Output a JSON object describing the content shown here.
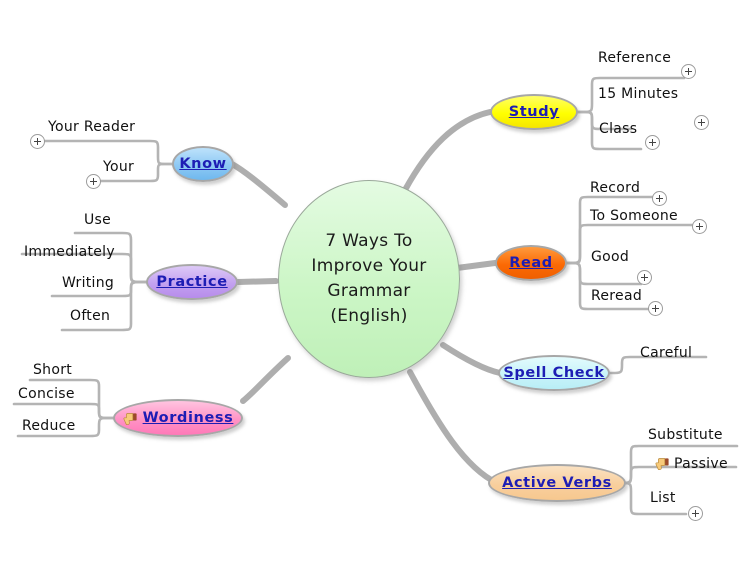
{
  "map": {
    "title": "7 Ways To Improve Your Grammar (English)",
    "central": {
      "lines": [
        "7 Ways To",
        "Improve Your",
        "Grammar",
        "(English)"
      ],
      "text": "7 Ways To\nImprove Your\nGrammar\n(English)",
      "fill": "#ccf6c6",
      "border": "#9aa89a"
    },
    "branches": [
      {
        "id": "know",
        "label": "Know",
        "side": "left",
        "fill": "#8ec9f4",
        "icon": null,
        "children": [
          {
            "label": "Your Reader",
            "plus": true,
            "icon": null
          },
          {
            "label": "Your",
            "plus": true,
            "icon": null
          }
        ]
      },
      {
        "id": "practice",
        "label": "Practice",
        "side": "left",
        "fill": "#c3a1f0",
        "icon": null,
        "children": [
          {
            "label": "Use",
            "plus": false,
            "icon": null
          },
          {
            "label": "Immediately",
            "plus": false,
            "icon": null
          },
          {
            "label": "Writing",
            "plus": false,
            "icon": null
          },
          {
            "label": "Often",
            "plus": false,
            "icon": null
          }
        ]
      },
      {
        "id": "wordiness",
        "label": "Wordiness",
        "side": "left",
        "fill": "#ff93c6",
        "icon": "thumbs-down-icon",
        "children": [
          {
            "label": "Short",
            "plus": false,
            "icon": null
          },
          {
            "label": "Concise",
            "plus": false,
            "icon": null
          },
          {
            "label": "Reduce",
            "plus": false,
            "icon": null
          }
        ]
      },
      {
        "id": "study",
        "label": "Study",
        "side": "right",
        "fill": "#ffff00",
        "icon": null,
        "children": [
          {
            "label": "Reference",
            "plus": true,
            "icon": null
          },
          {
            "label": "15 Minutes",
            "plus": true,
            "icon": null
          },
          {
            "label": "Class",
            "plus": true,
            "icon": null
          }
        ]
      },
      {
        "id": "read",
        "label": "Read",
        "side": "right",
        "fill": "#fb6a05",
        "icon": null,
        "children": [
          {
            "label": "Record",
            "plus": true,
            "icon": null
          },
          {
            "label": "To Someone",
            "plus": true,
            "icon": null
          },
          {
            "label": "Good",
            "plus": true,
            "icon": null
          },
          {
            "label": "Reread",
            "plus": true,
            "icon": null
          }
        ]
      },
      {
        "id": "spell-check",
        "label": "Spell Check",
        "side": "right",
        "fill": "#c8f3f9",
        "icon": null,
        "children": [
          {
            "label": "Careful",
            "plus": false,
            "icon": null
          }
        ]
      },
      {
        "id": "active-verbs",
        "label": "Active Verbs",
        "side": "right",
        "fill": "#f8cf9d",
        "icon": null,
        "children": [
          {
            "label": "Substitute",
            "plus": false,
            "icon": null
          },
          {
            "label": "Passive",
            "plus": false,
            "icon": "thumbs-down-icon"
          },
          {
            "label": "List",
            "plus": true,
            "icon": null
          }
        ]
      }
    ]
  }
}
